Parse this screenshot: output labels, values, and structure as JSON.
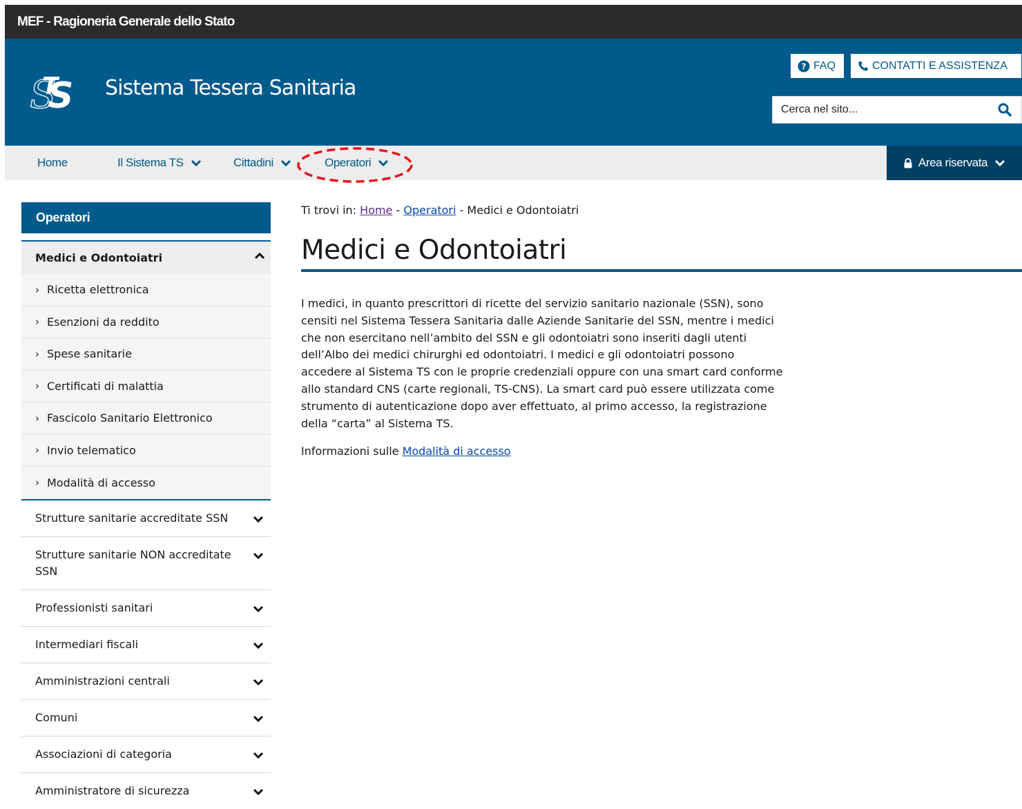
{
  "topbar": {
    "title": "MEF - Ragioneria Generale dello Stato"
  },
  "header": {
    "site_title": "Sistema Tessera Sanitaria",
    "faq_label": "FAQ",
    "contatti_label": "CONTATTI E ASSISTENZA",
    "search_placeholder": "Cerca nel sito..."
  },
  "nav": {
    "items": [
      {
        "label": "Home"
      },
      {
        "label": "Il Sistema TS"
      },
      {
        "label": "Cittadini"
      },
      {
        "label": "Operatori"
      }
    ],
    "area_riservata": "Area riservata"
  },
  "sidebar": {
    "heading": "Operatori",
    "active": "Medici e Odontoiatri",
    "sub_items": [
      "Ricetta elettronica",
      "Esenzioni da reddito",
      "Spese sanitarie",
      "Certificati di malattia",
      "Fascicolo Sanitario Elettronico",
      "Invio telematico",
      "Modalità di accesso"
    ],
    "categories": [
      "Strutture sanitarie accreditate SSN",
      "Strutture sanitarie NON accreditate SSN",
      "Professionisti sanitari",
      "Intermediari fiscali",
      "Amministrazioni centrali",
      "Comuni",
      "Associazioni di categoria",
      "Amministratore di sicurezza"
    ]
  },
  "breadcrumb": {
    "prefix": "Ti trovi in:",
    "home": "Home",
    "sep": "-",
    "operatori": "Operatori",
    "current": "Medici e Odontoiatri"
  },
  "main": {
    "title": "Medici e Odontoiatri",
    "paragraph": "I medici, in quanto prescrittori di ricette del servizio sanitario nazionale (SSN), sono censiti nel Sistema Tessera Sanitaria dalle Aziende Sanitarie del SSN, mentre i medici che non esercitano nell’ambito del SSN e gli odontoiatri sono inseriti dagli utenti dell’Albo dei medici chirurghi ed odontoiatri. I medici e gli odontoiatri possono accedere al Sistema TS con le proprie credenziali oppure con una smart card conforme allo standard CNS (carte regionali, TS-CNS). La smart card può essere utilizzata come strumento di autenticazione dopo aver effettuato, al primo accesso, la registrazione della “carta” al Sistema TS.",
    "info_prefix": "Informazioni sulle",
    "info_link": "Modalità di accesso"
  },
  "colors": {
    "brand_blue": "#005a8c",
    "dark_blue": "#004063",
    "topbar": "#2b2b2b",
    "annotation_red": "#e8151b"
  }
}
